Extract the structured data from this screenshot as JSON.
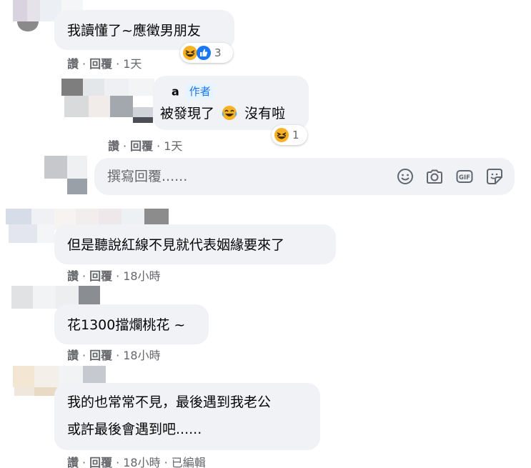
{
  "comments": [
    {
      "text_lines": [
        "我讀懂了~應徵男朋友"
      ],
      "actions": {
        "like": "讚",
        "reply": "回覆",
        "time": "1天",
        "edited": ""
      },
      "reaction_count": "3"
    },
    {
      "author": {
        "name": "a",
        "badge": "作者"
      },
      "text_before_emoji": "被發現了",
      "text_after_emoji": "沒有啦",
      "actions": {
        "like": "讚",
        "reply": "回覆",
        "time": "1天"
      },
      "reaction_count": "1"
    },
    {
      "text_lines": [
        "但是聽說紅線不見就代表姻緣要來了"
      ],
      "actions": {
        "like": "讚",
        "reply": "回覆",
        "time": "18小時"
      }
    },
    {
      "text_lines": [
        "花1300擋爛桃花 ~"
      ],
      "actions": {
        "like": "讚",
        "reply": "回覆",
        "time": "18小時"
      }
    },
    {
      "text_lines": [
        "我的也常常不見，最後遇到我老公",
        "或許最後會遇到吧......"
      ],
      "actions": {
        "like": "讚",
        "reply": "回覆",
        "time": "18小時",
        "edited": "已編輯"
      }
    }
  ],
  "reply_box": {
    "placeholder": "撰寫回覆......",
    "tools": [
      "emoji-icon",
      "camera-icon",
      "gif-icon",
      "sticker-icon"
    ]
  },
  "colors": {
    "bubble": "#f0f2f5",
    "meta_text": "#65676b",
    "author_badge_bg": "#e7f3ff",
    "author_badge_text": "#1877f2",
    "like_blue": "#1877f2",
    "emoji_yellow": "#f7b125"
  }
}
